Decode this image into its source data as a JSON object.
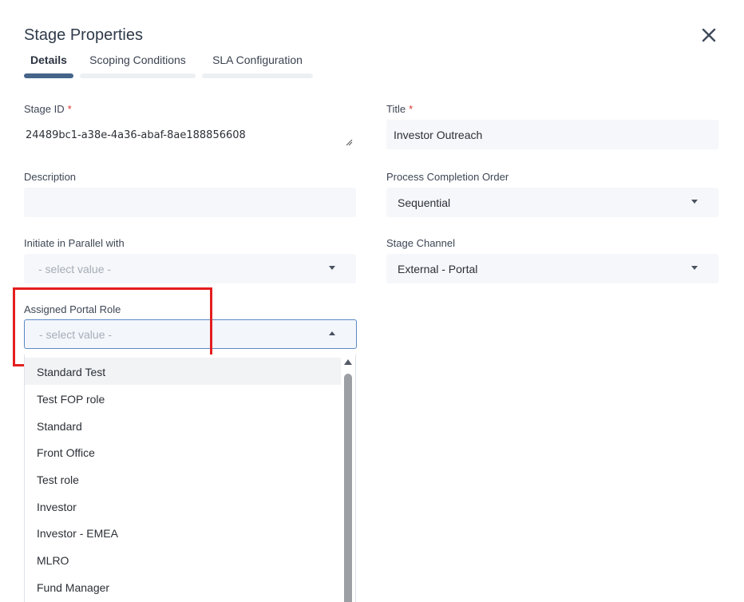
{
  "dialog": {
    "title": "Stage Properties"
  },
  "tabs": [
    {
      "label": "Details",
      "active": true
    },
    {
      "label": "Scoping Conditions",
      "active": false
    },
    {
      "label": "SLA Configuration",
      "active": false
    }
  ],
  "fields": {
    "stage_id": {
      "label": "Stage ID",
      "required_mark": "*",
      "value": "24489bc1-a38e-4a36-abaf-8ae188856608"
    },
    "title": {
      "label": "Title",
      "required_mark": "*",
      "value": "Investor Outreach"
    },
    "description": {
      "label": "Description",
      "value": ""
    },
    "process_completion_order": {
      "label": "Process Completion Order",
      "value": "Sequential"
    },
    "initiate_in_parallel": {
      "label": "Initiate in Parallel with",
      "placeholder": "- select value -"
    },
    "stage_channel": {
      "label": "Stage Channel",
      "value": "External - Portal"
    },
    "assigned_portal_role": {
      "label": "Assigned Portal Role",
      "placeholder": "- select value -",
      "expanded": true
    }
  },
  "portal_role_options": [
    "Standard Test",
    "Test FOP role",
    "Standard",
    "Front Office",
    "Test role",
    "Investor",
    "Investor - EMEA",
    "MLRO",
    "Fund Manager"
  ],
  "colors": {
    "accent": "#46648a",
    "highlight_box": "#e41e1e",
    "required": "#e0332f",
    "field_bg": "#f5f7fa"
  },
  "icons": [
    "close-icon",
    "resize-handle-icon",
    "caret-down-icon",
    "caret-up-icon",
    "scroll-up-arrow-icon"
  ]
}
